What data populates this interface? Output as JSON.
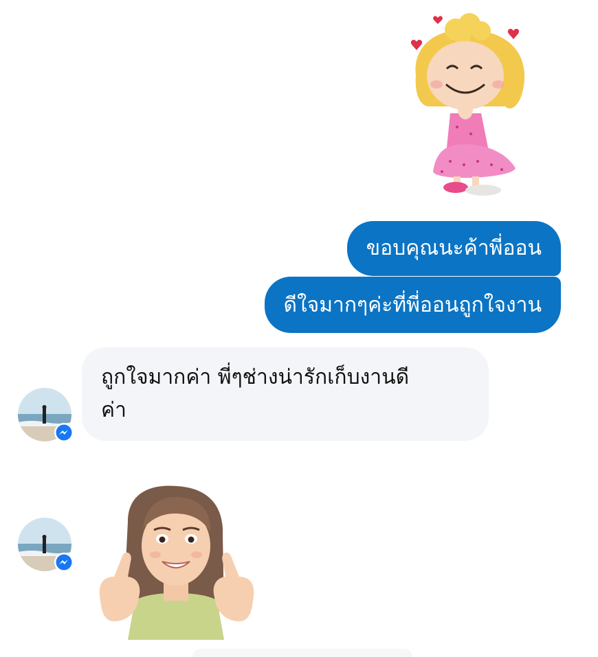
{
  "messages": {
    "outgoing": [
      {
        "text": "ขอบคุณนะค้าพี่ออน"
      },
      {
        "text": "ดีใจมากๆค่ะที่พี่ออนถูกใจงาน"
      }
    ],
    "incoming": {
      "lines": [
        "ถูกใจมากค่า พี่ๆช่างน่ารักเก็บงานดี",
        "ค่า"
      ]
    }
  },
  "stickers": {
    "top": "sally-praying-sticker",
    "bottom": "memoji-thumbs-up-sticker"
  },
  "colors": {
    "outgoing_bubble": "#0b74c4",
    "incoming_bubble": "#f3f5f8",
    "messenger_badge": "#1877f2"
  },
  "icons": {
    "badge": "messenger-icon"
  }
}
